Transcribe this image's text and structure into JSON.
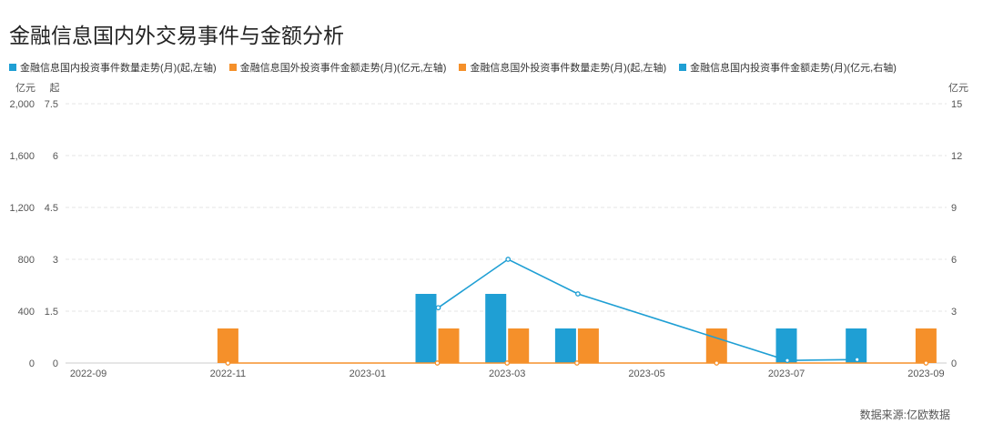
{
  "title": "金融信息国内外交易事件与金额分析",
  "source": "数据来源:亿欧数据",
  "chart_data": {
    "type": "bar",
    "categories": [
      "2022-09",
      "2022-10",
      "2022-11",
      "2022-12",
      "2023-01",
      "2023-02",
      "2023-03",
      "2023-04",
      "2023-05",
      "2023-06",
      "2023-07",
      "2023-08",
      "2023-09"
    ],
    "x_tick_labels": [
      "2022-09",
      "2022-11",
      "2023-01",
      "2023-03",
      "2023-05",
      "2023-07",
      "2023-09"
    ],
    "left_axis_1": {
      "unit": "亿元",
      "ticks": [
        "2,000",
        "1,600",
        "1,200",
        "800",
        "400",
        "0"
      ],
      "range": [
        0,
        2000
      ]
    },
    "left_axis_2": {
      "unit": "起",
      "ticks": [
        "7.5",
        "6",
        "4.5",
        "3",
        "1.5",
        "0"
      ],
      "range": [
        0,
        7.5
      ]
    },
    "right_axis": {
      "unit": "亿元",
      "ticks": [
        "15",
        "12",
        "9",
        "6",
        "3",
        "0"
      ],
      "range": [
        0,
        15
      ]
    },
    "series": [
      {
        "name": "金融信息国内投资事件数量走势(月)(起,左轴)",
        "kind": "bar",
        "axis": "left_count",
        "color": "#1f9fd4",
        "values": [
          null,
          null,
          null,
          null,
          null,
          2,
          2,
          1,
          null,
          null,
          1,
          1,
          null
        ]
      },
      {
        "name": "金融信息国外投资事件金额走势(月)(亿元,左轴)",
        "kind": "line",
        "axis": "left_amount",
        "color": "#f5902a",
        "values": [
          null,
          null,
          0,
          null,
          null,
          0,
          0,
          0,
          null,
          0,
          null,
          null,
          0
        ]
      },
      {
        "name": "金融信息国外投资事件数量走势(月)(起,左轴)",
        "kind": "bar",
        "axis": "left_count",
        "color": "#f5902a",
        "values": [
          null,
          null,
          1,
          null,
          null,
          1,
          1,
          1,
          null,
          1,
          null,
          null,
          1
        ]
      },
      {
        "name": "金融信息国内投资事件金额走势(月)(亿元,右轴)",
        "kind": "line",
        "axis": "right_amount",
        "color": "#1f9fd4",
        "values": [
          null,
          null,
          null,
          null,
          null,
          3.2,
          6.0,
          4.0,
          null,
          null,
          0.15,
          0.2,
          null
        ]
      }
    ],
    "grid": true,
    "legend_position": "top-left"
  }
}
